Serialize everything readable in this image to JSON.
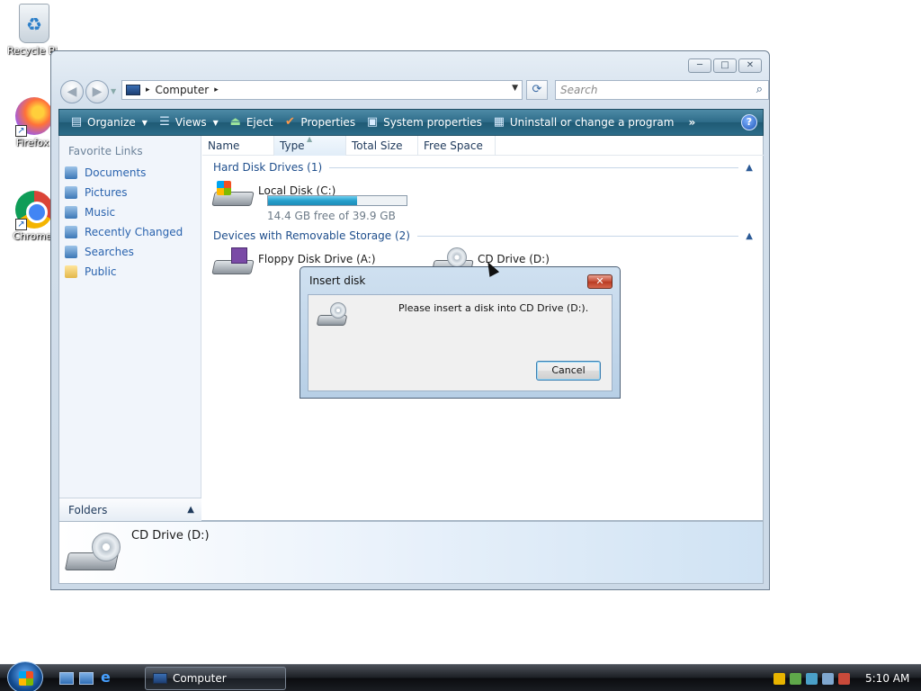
{
  "desktop": {
    "icons": [
      {
        "label": "Recycle Bin"
      },
      {
        "label": "Firefox"
      },
      {
        "label": "Chrome"
      }
    ]
  },
  "window": {
    "caption": {
      "minimize": "─",
      "maximize": "□",
      "close": "✕"
    },
    "address": {
      "crumb": "Computer",
      "sep": "▸"
    },
    "search": {
      "placeholder": "Search"
    },
    "toolbar": {
      "organize": "Organize",
      "views": "Views",
      "eject": "Eject",
      "properties": "Properties",
      "system_properties": "System properties",
      "uninstall": "Uninstall or change a program",
      "more": "»",
      "help": "?"
    },
    "favorites": {
      "title": "Favorite Links",
      "items": [
        {
          "label": "Documents",
          "icon": "documents-icon"
        },
        {
          "label": "Pictures",
          "icon": "pictures-icon"
        },
        {
          "label": "Music",
          "icon": "music-icon"
        },
        {
          "label": "Recently Changed",
          "icon": "recently-changed-icon"
        },
        {
          "label": "Searches",
          "icon": "searches-icon"
        },
        {
          "label": "Public",
          "icon": "folder-icon"
        }
      ],
      "folders_label": "Folders"
    },
    "columns": [
      "Name",
      "Type",
      "Total Size",
      "Free Space"
    ],
    "groups": {
      "hard_disk": "Hard Disk Drives (1)",
      "removable": "Devices with Removable Storage (2)"
    },
    "drives": {
      "local": {
        "name": "Local Disk (C:)",
        "free_text": "14.4 GB free of 39.9 GB",
        "used_fraction": 0.64
      },
      "floppy": {
        "name": "Floppy Disk Drive (A:)"
      },
      "cd": {
        "name": "CD Drive (D:)"
      }
    },
    "details": {
      "name": "CD Drive (D:)"
    }
  },
  "dialog": {
    "title": "Insert disk",
    "close": "✕",
    "message": "Please insert a disk into CD Drive (D:).",
    "cancel": "Cancel"
  },
  "taskbar": {
    "task_label": "Computer",
    "clock": "5:10 AM"
  },
  "colors": {
    "toolbar": "#2d6b88",
    "usage_fill": "#26a0cc",
    "link": "#2a63ae"
  }
}
